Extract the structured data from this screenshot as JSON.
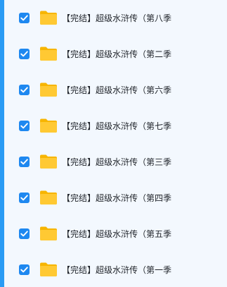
{
  "colors": {
    "accent": "#2a9bf4",
    "checkbox": "#1e88f0",
    "folder": "#ffc933",
    "background": "#f3f8fe",
    "text": "#1f2329"
  },
  "items": [
    {
      "name": "【完结】超级水浒传（第八季",
      "checked": true,
      "icon": "folder-icon"
    },
    {
      "name": "【完结】超级水浒传（第二季",
      "checked": true,
      "icon": "folder-icon"
    },
    {
      "name": "【完结】超级水浒传（第六季",
      "checked": true,
      "icon": "folder-icon"
    },
    {
      "name": "【完结】超级水浒传（第七季",
      "checked": true,
      "icon": "folder-icon"
    },
    {
      "name": "【完结】超级水浒传（第三季",
      "checked": true,
      "icon": "folder-icon"
    },
    {
      "name": "【完结】超级水浒传（第四季",
      "checked": true,
      "icon": "folder-icon"
    },
    {
      "name": "【完结】超级水浒传（第五季",
      "checked": true,
      "icon": "folder-icon"
    },
    {
      "name": "【完结】超级水浒传（第一季",
      "checked": true,
      "icon": "folder-icon"
    }
  ]
}
